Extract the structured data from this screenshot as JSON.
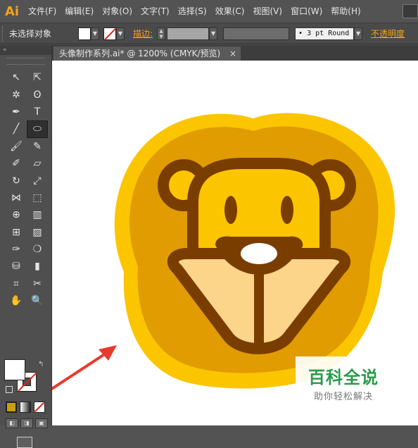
{
  "app": {
    "logo": "Ai"
  },
  "menu": [
    "文件(F)",
    "编辑(E)",
    "对象(O)",
    "文字(T)",
    "选择(S)",
    "效果(C)",
    "视图(V)",
    "窗口(W)",
    "帮助(H)"
  ],
  "control_bar": {
    "selection_label": "未选择对象",
    "stroke_label": "描边:",
    "brush_value": "• 3 pt Round",
    "opacity_label": "不透明度"
  },
  "document_tab": {
    "title": "头像制作系列.ai* @ 1200% (CMYK/预览)",
    "close": "×"
  },
  "tools": [
    {
      "icon": "selection-icon",
      "glyph": "↖"
    },
    {
      "icon": "direct-selection-icon",
      "glyph": "⇱"
    },
    {
      "icon": "magic-wand-icon",
      "glyph": "✲"
    },
    {
      "icon": "lasso-icon",
      "glyph": "ʘ"
    },
    {
      "icon": "pen-icon",
      "glyph": "✒"
    },
    {
      "icon": "type-icon",
      "glyph": "T"
    },
    {
      "icon": "line-segment-icon",
      "glyph": "╱"
    },
    {
      "icon": "ellipse-icon",
      "glyph": "⬭"
    },
    {
      "icon": "paintbrush-icon",
      "glyph": "🖌"
    },
    {
      "icon": "pencil-icon",
      "glyph": "✎"
    },
    {
      "icon": "blob-brush-icon",
      "glyph": "✐"
    },
    {
      "icon": "eraser-icon",
      "glyph": "▱"
    },
    {
      "icon": "rotate-icon",
      "glyph": "↻"
    },
    {
      "icon": "scale-icon",
      "glyph": "⤢"
    },
    {
      "icon": "width-icon",
      "glyph": "⋈"
    },
    {
      "icon": "free-transform-icon",
      "glyph": "⬚"
    },
    {
      "icon": "shape-builder-icon",
      "glyph": "⊕"
    },
    {
      "icon": "graph-icon",
      "glyph": "▥"
    },
    {
      "icon": "mesh-icon",
      "glyph": "⊞"
    },
    {
      "icon": "gradient-icon",
      "glyph": "▨"
    },
    {
      "icon": "eyedropper-icon",
      "glyph": "✑"
    },
    {
      "icon": "blend-icon",
      "glyph": "❍"
    },
    {
      "icon": "symbol-sprayer-icon",
      "glyph": "⛁"
    },
    {
      "icon": "column-graph-icon",
      "glyph": "▮"
    },
    {
      "icon": "artboard-icon",
      "glyph": "⌗"
    },
    {
      "icon": "slice-icon",
      "glyph": "✂"
    },
    {
      "icon": "hand-icon",
      "glyph": "✋"
    },
    {
      "icon": "zoom-icon",
      "glyph": "🔍"
    }
  ],
  "colors": {
    "canvas": "#ffffff",
    "mane_outer": "#fbc500",
    "mane_inner": "#e09c00",
    "outline": "#7a3d00",
    "face": "#fbc500",
    "muzzle": "#fcd48a",
    "nose": "#ffffff",
    "arrow": "#e83a2e",
    "watermark_green": "#2b9a4a"
  },
  "watermark": {
    "title": "百科全说",
    "subtitle": "助你轻松解决"
  }
}
